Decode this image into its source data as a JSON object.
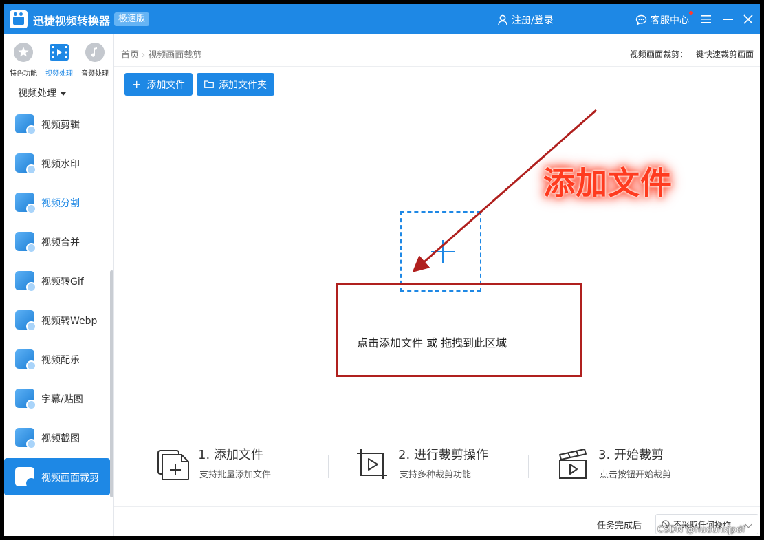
{
  "app": {
    "title": "迅捷视频转换器",
    "badge": "极速版",
    "login": "注册/登录",
    "service": "客服中心",
    "brand_color": "#1e88e5"
  },
  "top_tabs": [
    {
      "label": "特色功能",
      "icon": "star-icon"
    },
    {
      "label": "视频处理",
      "icon": "film-icon",
      "active": true
    },
    {
      "label": "音频处理",
      "icon": "music-icon"
    }
  ],
  "sidebar": {
    "category": "视频处理",
    "items": [
      {
        "label": "视频剪辑",
        "icon": "video-edit-icon"
      },
      {
        "label": "视频水印",
        "icon": "watermark-icon"
      },
      {
        "label": "视频分割",
        "icon": "split-icon",
        "current": true
      },
      {
        "label": "视频合并",
        "icon": "merge-icon"
      },
      {
        "label": "视频转Gif",
        "icon": "gif-icon"
      },
      {
        "label": "视频转Webp",
        "icon": "webp-icon"
      },
      {
        "label": "视频配乐",
        "icon": "music-note-icon"
      },
      {
        "label": "字幕/贴图",
        "icon": "sticker-icon"
      },
      {
        "label": "视频截图",
        "icon": "screenshot-icon"
      },
      {
        "label": "视频画面裁剪",
        "icon": "crop-icon",
        "selected": true
      }
    ]
  },
  "breadcrumb": {
    "home": "首页",
    "current": "视频画面裁剪"
  },
  "header_desc": "视频画面裁剪：一键快速裁剪画面",
  "toolbar": {
    "add_file": "添加文件",
    "add_folder": "添加文件夹"
  },
  "drop": {
    "hint": "点击添加文件 或 拖拽到此区域"
  },
  "annotation": {
    "text": "添加文件",
    "color": "#ff3b1f"
  },
  "steps": [
    {
      "title": "1. 添加文件",
      "desc": "支持批量添加文件",
      "icon": "add-file-icon"
    },
    {
      "title": "2. 进行裁剪操作",
      "desc": "支持多种裁剪功能",
      "icon": "crop-play-icon"
    },
    {
      "title": "3. 开始裁剪",
      "desc": "点击按钮开始裁剪",
      "icon": "clapper-icon"
    }
  ],
  "footer": {
    "label": "任务完成后",
    "option": "不采取任何操作"
  },
  "watermark": "CSDN @hudunkjpdf"
}
